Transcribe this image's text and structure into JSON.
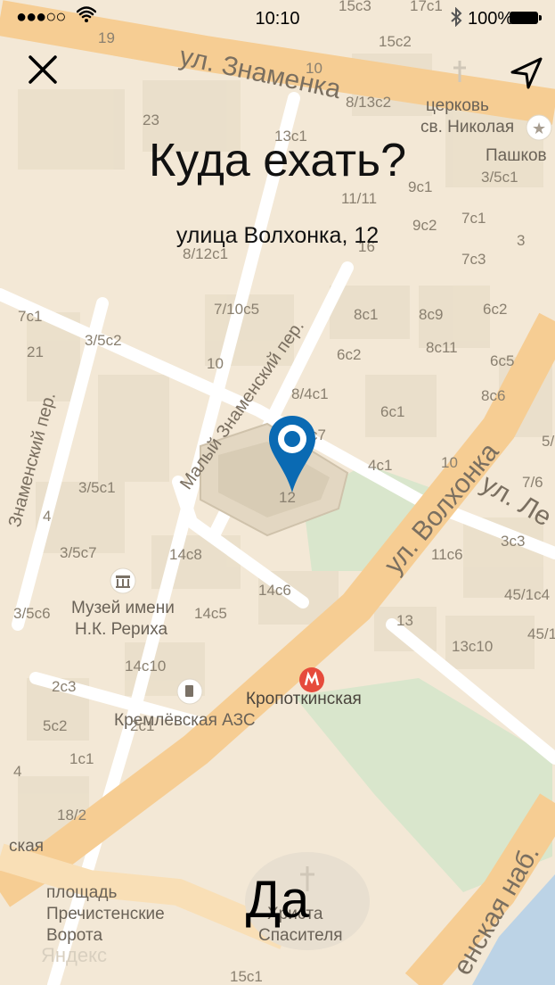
{
  "status_bar": {
    "signal": "●●●○○",
    "time": "10:10",
    "battery": "100%"
  },
  "header": {
    "title": "Куда ехать?",
    "address": "улица Волхонка, 12"
  },
  "actions": {
    "confirm_label": "Да"
  },
  "map": {
    "streets": {
      "znamenka": "ул. Знаменка",
      "maly_znamensky": "Малый Знаменский пер.",
      "znamensky": "Знаменский пер.",
      "volkhonka": "ул. Волхонка",
      "lenivka": "ул. Ле",
      "naberezhnaya": "енская наб."
    },
    "pois": {
      "church_line1": "церковь",
      "church_line2": "св. Николая",
      "pashkov": "Пашков",
      "museum_line1": "Музей имени",
      "museum_line2": "Н.К. Рериха",
      "gas_station": "Кремлёвская АЗС",
      "metro": "Кропоткинская",
      "square_line1": "площадь",
      "square_line2": "Пречистенские",
      "square_line3": "Ворота",
      "cathedral_line1": "Христа",
      "cathedral_line2": "Спасителя",
      "left_edge": "ская",
      "yandex": "Яндекс"
    },
    "house_numbers": [
      "19",
      "15c3",
      "17c1",
      "10",
      "15c2",
      "8/13c2",
      "13c1",
      "23",
      "11/11",
      "9c1",
      "9c2",
      "7c1",
      "3/5c1",
      "8/12c1",
      "16",
      "7c3",
      "3",
      "7c1",
      "7/10c5",
      "8c1",
      "8c9",
      "6c2",
      "21",
      "3/5c2",
      "6c2",
      "8c11",
      "10",
      "6c5",
      "8/4c1",
      "8c6",
      "6c1",
      "c7",
      "5/",
      "4c1",
      "10",
      "7/6",
      "3/5c1",
      "12",
      "4",
      "3c3",
      "3/5c7",
      "14c8",
      "11c6",
      "14c6",
      "45/1c4",
      "3/5c6",
      "14c5",
      "13",
      "45/1",
      "14c10",
      "13c10",
      "2c3",
      "5c2",
      "2c1",
      "1c1",
      "4",
      "18/2",
      "15c1"
    ]
  },
  "colors": {
    "map_background": "#f4ead9",
    "road_major": "#f5c98a",
    "pin": "#0a6ab3",
    "metro": "#e64b3c",
    "park": "#cfe2c3"
  }
}
